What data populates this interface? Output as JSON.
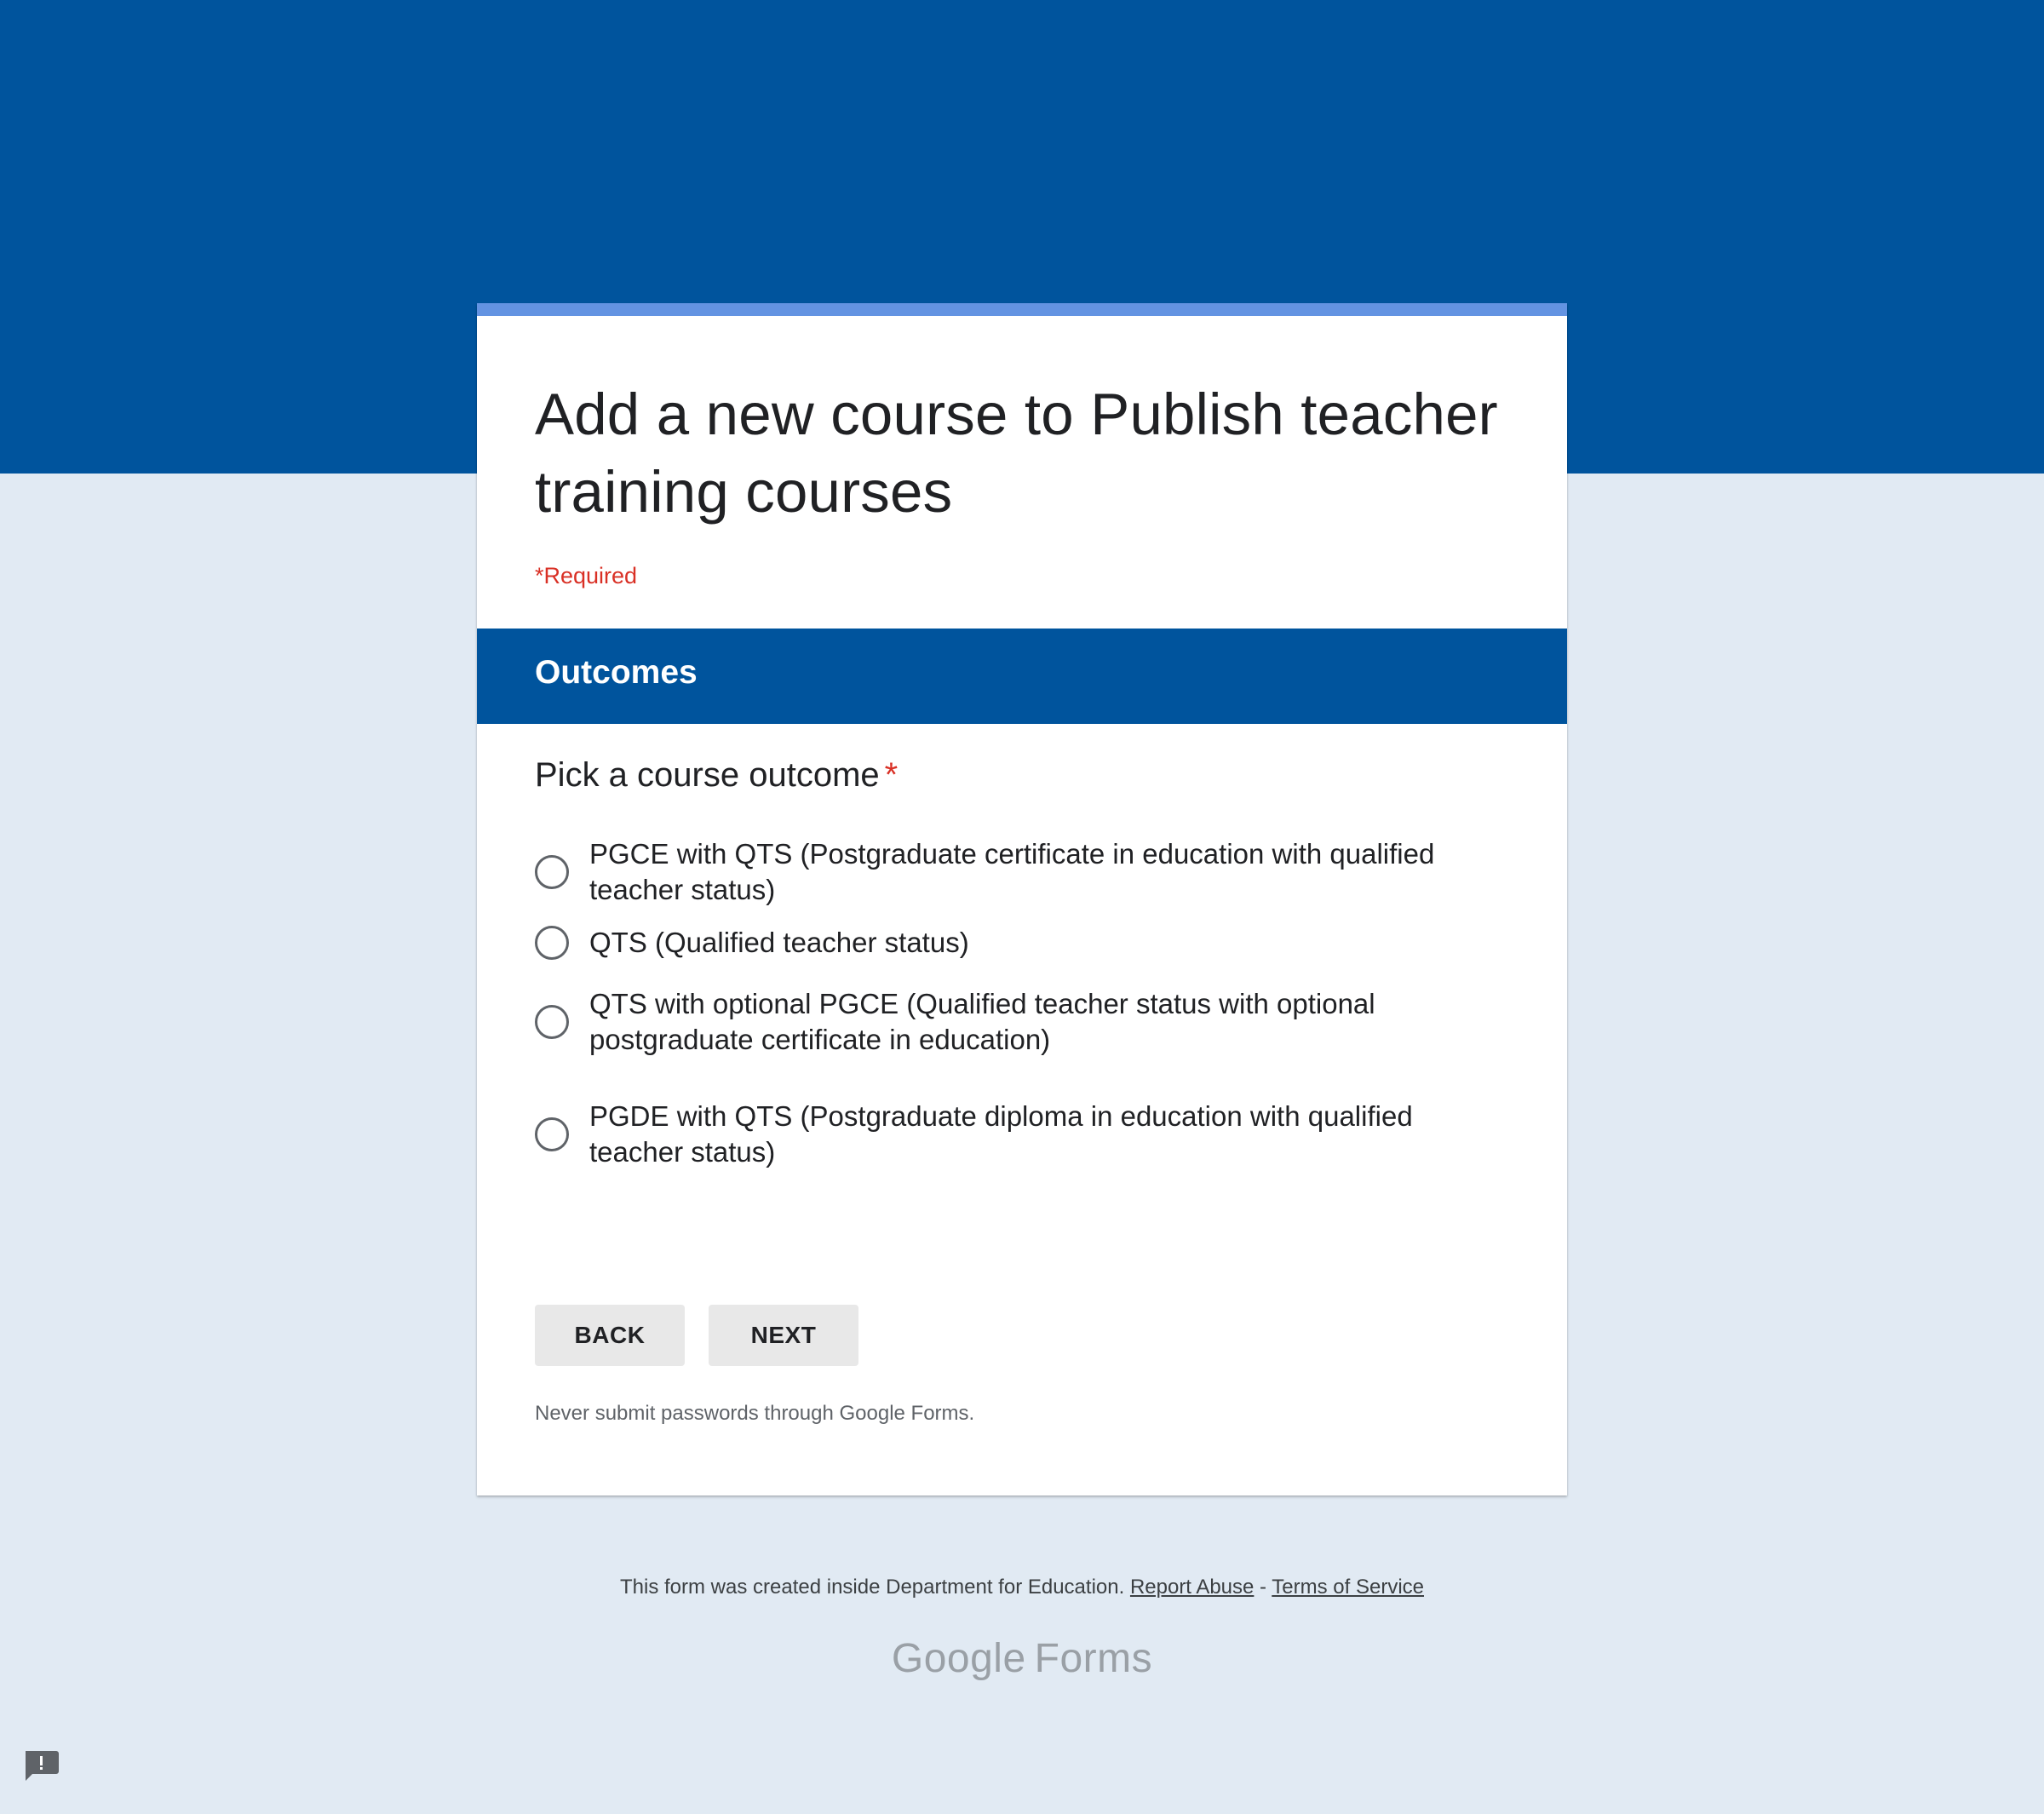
{
  "form": {
    "title": "Add a new course to Publish teacher training courses",
    "required_note": "*Required"
  },
  "section": {
    "title": "Outcomes"
  },
  "question": {
    "title": "Pick a course outcome",
    "required_mark": "*",
    "options": [
      {
        "label": "PGCE with QTS (Postgraduate certificate in education with qualified teacher status)",
        "selected": false
      },
      {
        "label": "QTS (Qualified teacher status)",
        "selected": false
      },
      {
        "label": "QTS with optional PGCE (Qualified teacher status with optional postgraduate certificate in education)",
        "selected": false
      },
      {
        "label": "PGDE with QTS (Postgraduate diploma in education with qualified teacher status)",
        "selected": false
      }
    ]
  },
  "buttons": {
    "back_label": "BACK",
    "next_label": "NEXT"
  },
  "notes": {
    "password_warning": "Never submit passwords through Google Forms."
  },
  "footer": {
    "created_text": "This form was created inside Department for Education.",
    "report_abuse": "Report Abuse",
    "separator": "-",
    "terms": "Terms of Service"
  },
  "logo": {
    "google": "Google",
    "forms": "Forms"
  },
  "icons": {
    "feedback": "report-feedback-icon"
  },
  "colors": {
    "header_blue": "#00549d",
    "accent_blue": "#6393e2",
    "page_background": "#e1eaf3",
    "required_red": "#d93025"
  }
}
